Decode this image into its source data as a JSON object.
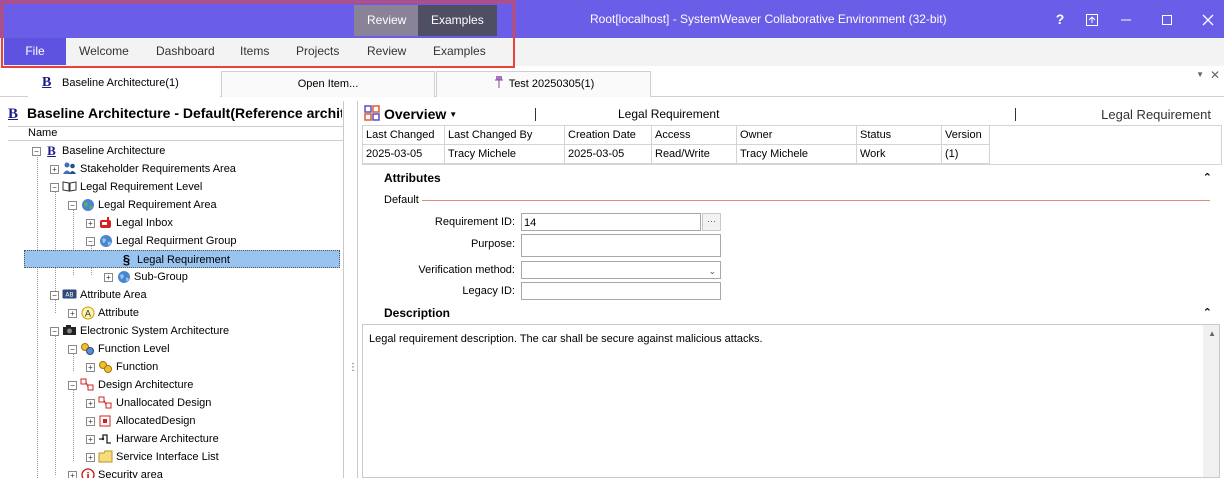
{
  "titlebar": {
    "context_tabs": [
      "Review",
      "Examples"
    ],
    "window_title": "Root[localhost] - SystemWeaver Collaborative Environment (32-bit)",
    "buttons": {
      "help": "?",
      "restore_alt": "⊼",
      "minimize": "—",
      "maximize": "☐",
      "close": "✕"
    }
  },
  "ribbon": {
    "file": "File",
    "menu": [
      "Welcome",
      "Dashboard",
      "Items",
      "Projects",
      "Review",
      "Examples"
    ]
  },
  "doc_tabs": [
    {
      "label": "Baseline Architecture(1)",
      "icon": "baseline-icon"
    },
    {
      "label": "Open Item...",
      "icon": ""
    },
    {
      "label": "Test 20250305(1)",
      "icon": "test-icon"
    }
  ],
  "tree": {
    "title": "Baseline Architecture - Default(Reference architect",
    "column": "Name",
    "nodes": [
      {
        "label": "Baseline Architecture",
        "icon": "baseline-icon"
      },
      {
        "label": "Stakeholder Requirements Area",
        "icon": "people-icon"
      },
      {
        "label": "Legal Requirement Level",
        "icon": "book-icon"
      },
      {
        "label": "Legal Requirement Area",
        "icon": "globe-icon"
      },
      {
        "label": "Legal Inbox",
        "icon": "mailbox-icon"
      },
      {
        "label": "Legal Requirment Group",
        "icon": "globe-icon"
      },
      {
        "label": "Legal Requirement",
        "icon": "section-icon"
      },
      {
        "label": "Sub-Group",
        "icon": "globe-icon"
      },
      {
        "label": "Attribute Area",
        "icon": "attribute-area-icon"
      },
      {
        "label": "Attribute",
        "icon": "attribute-icon"
      },
      {
        "label": "Electronic System Architecture",
        "icon": "camera-icon"
      },
      {
        "label": "Function Level",
        "icon": "function-level-icon"
      },
      {
        "label": "Function",
        "icon": "function-icon"
      },
      {
        "label": "Design Architecture",
        "icon": "design-icon"
      },
      {
        "label": "Unallocated Design",
        "icon": "design-icon"
      },
      {
        "label": "AllocatedDesign",
        "icon": "allocated-icon"
      },
      {
        "label": "Harware Architecture",
        "icon": "hardware-icon"
      },
      {
        "label": "Service Interface List",
        "icon": "folder-icon"
      },
      {
        "label": "Security area",
        "icon": "info-icon"
      }
    ]
  },
  "item": {
    "overview_label": "Overview",
    "type_center": "Legal Requirement",
    "type_right": "Legal Requirement",
    "meta_headers": [
      "Last Changed",
      "Last Changed By",
      "Creation Date",
      "Access",
      "Owner",
      "Status",
      "Version"
    ],
    "meta_values": [
      "2025-03-05",
      "Tracy Michele",
      "2025-03-05",
      "Read/Write",
      "Tracy Michele",
      "Work",
      "(1)"
    ],
    "attributes_title": "Attributes",
    "default_group": "Default",
    "fields": [
      {
        "label": "Requirement ID:",
        "value": "14"
      },
      {
        "label": "Purpose:",
        "value": ""
      },
      {
        "label": "Verification method:",
        "value": ""
      },
      {
        "label": "Legacy ID:",
        "value": ""
      }
    ],
    "description_title": "Description",
    "description_text": "Legal requirement description. The car shall be secure against malicious attacks."
  },
  "colors": {
    "titlebar": "#6a5de8",
    "file_button": "#5e52e0",
    "selection": "#99c4ef",
    "highlight": "#e8423b"
  }
}
